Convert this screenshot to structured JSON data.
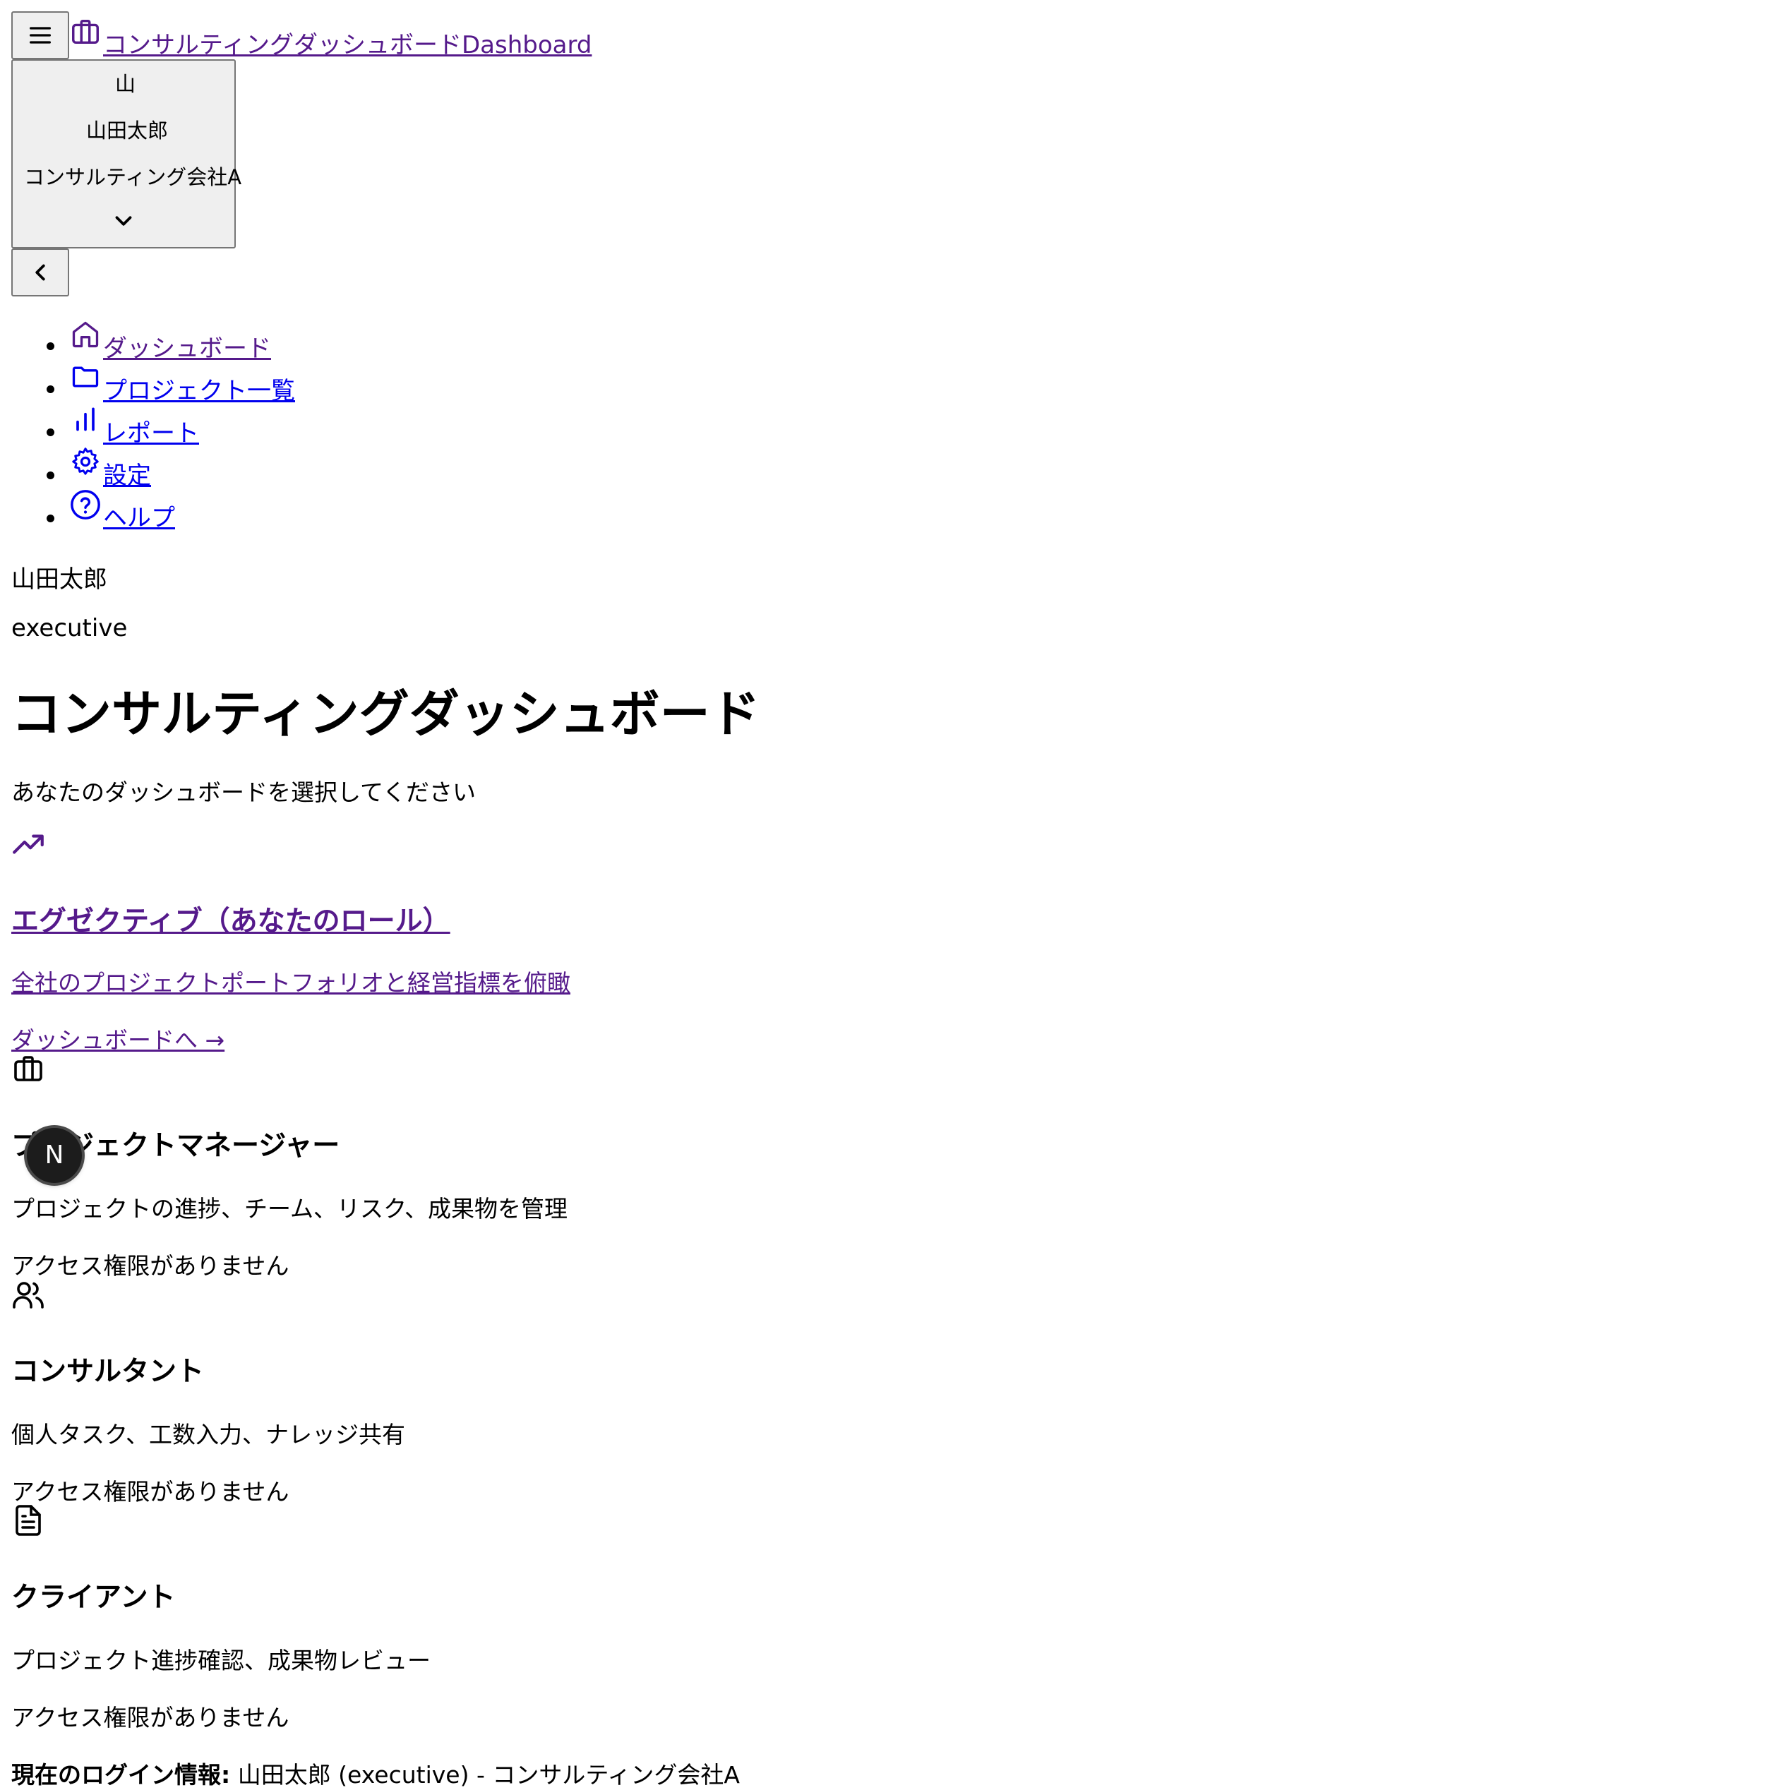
{
  "header": {
    "brand_label": "コンサルティングダッシュボードDashboard",
    "menu_icon": "hamburger-icon",
    "brand_icon": "briefcase-icon"
  },
  "user_menu": {
    "avatar_initial": "山",
    "name": "山田太郎",
    "company": "コンサルティング会社A",
    "chevron_icon": "chevron-down-icon"
  },
  "collapse_button": {
    "icon": "chevron-left-icon"
  },
  "nav": {
    "items": [
      {
        "label": "ダッシュボード",
        "icon": "home-icon"
      },
      {
        "label": "プロジェクト一覧",
        "icon": "folder-icon"
      },
      {
        "label": "レポート",
        "icon": "bar-chart-icon"
      },
      {
        "label": "設定",
        "icon": "gear-icon"
      },
      {
        "label": "ヘルプ",
        "icon": "help-circle-icon"
      }
    ]
  },
  "sidebar_user": {
    "name": "山田太郎",
    "role": "executive"
  },
  "main": {
    "title": "コンサルティングダッシュボード",
    "subtitle": "あなたのダッシュボードを選択してください",
    "cards": [
      {
        "icon": "trending-up-icon",
        "title": "エグゼクティブ（あなたのロール）",
        "description": "全社のプロジェクトポートフォリオと経営指標を俯瞰",
        "action": "ダッシュボードへ →"
      },
      {
        "icon": "briefcase-icon",
        "title": "プロジェクトマネージャー",
        "description": "プロジェクトの進捗、チーム、リスク、成果物を管理",
        "status": "アクセス権限がありません"
      },
      {
        "icon": "users-icon",
        "title": "コンサルタント",
        "description": "個人タスク、工数入力、ナレッジ共有",
        "status": "アクセス権限がありません"
      },
      {
        "icon": "file-text-icon",
        "title": "クライアント",
        "description": "プロジェクト進捗確認、成果物レビュー",
        "status": "アクセス権限がありません"
      }
    ],
    "login_info_label": "現在のログイン情報:",
    "login_info_value": " 山田太郎 (executive) - コンサルティング会社A"
  },
  "dev_badge": {
    "letter": "N",
    "icon": "nextjs-logo-icon"
  },
  "colors": {
    "link": "#0000ee",
    "visited": "#551a8b",
    "button_bg": "#efefef",
    "button_border": "#767676"
  }
}
